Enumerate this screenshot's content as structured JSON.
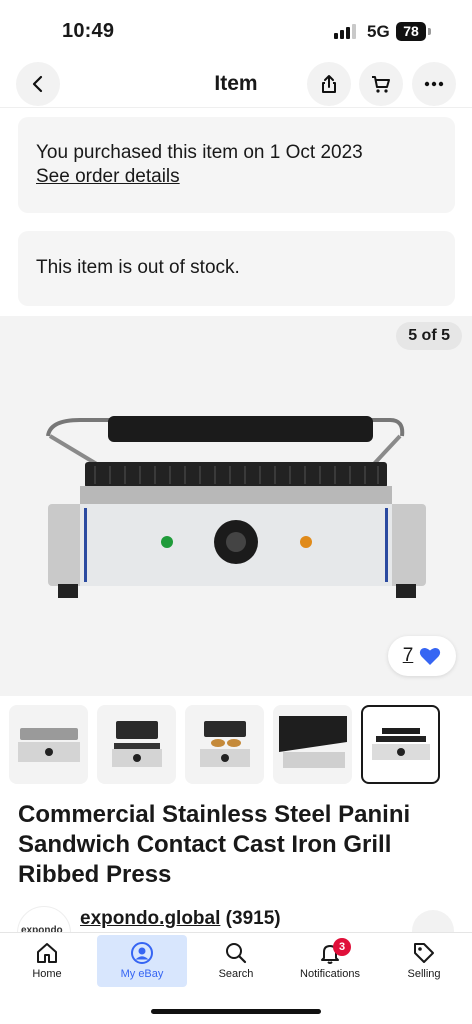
{
  "status_bar": {
    "time": "10:49",
    "network": "5G",
    "battery": "78"
  },
  "header": {
    "title": "Item"
  },
  "purchase_card": {
    "text": "You purchased this item on 1 Oct 2023",
    "link": "See order details"
  },
  "stock_card": {
    "text": "This item is out of stock."
  },
  "gallery": {
    "counter": "5 of 5",
    "watch_count": "7"
  },
  "product": {
    "title": "Commercial Stainless Steel Panini Sandwich Contact Cast Iron Grill Ribbed Press"
  },
  "seller": {
    "logo_text": "expondo",
    "name": "expondo.global",
    "feedback": "(3915)"
  },
  "tabs": [
    {
      "label": "Home",
      "icon": "home-icon"
    },
    {
      "label": "My eBay",
      "icon": "user-icon"
    },
    {
      "label": "Search",
      "icon": "search-icon"
    },
    {
      "label": "Notifications",
      "icon": "bell-icon",
      "badge": "3"
    },
    {
      "label": "Selling",
      "icon": "tag-icon"
    }
  ],
  "colors": {
    "accent": "#3665f3",
    "badge": "#e0103a",
    "active_tab_bg": "#d8e6fd"
  }
}
